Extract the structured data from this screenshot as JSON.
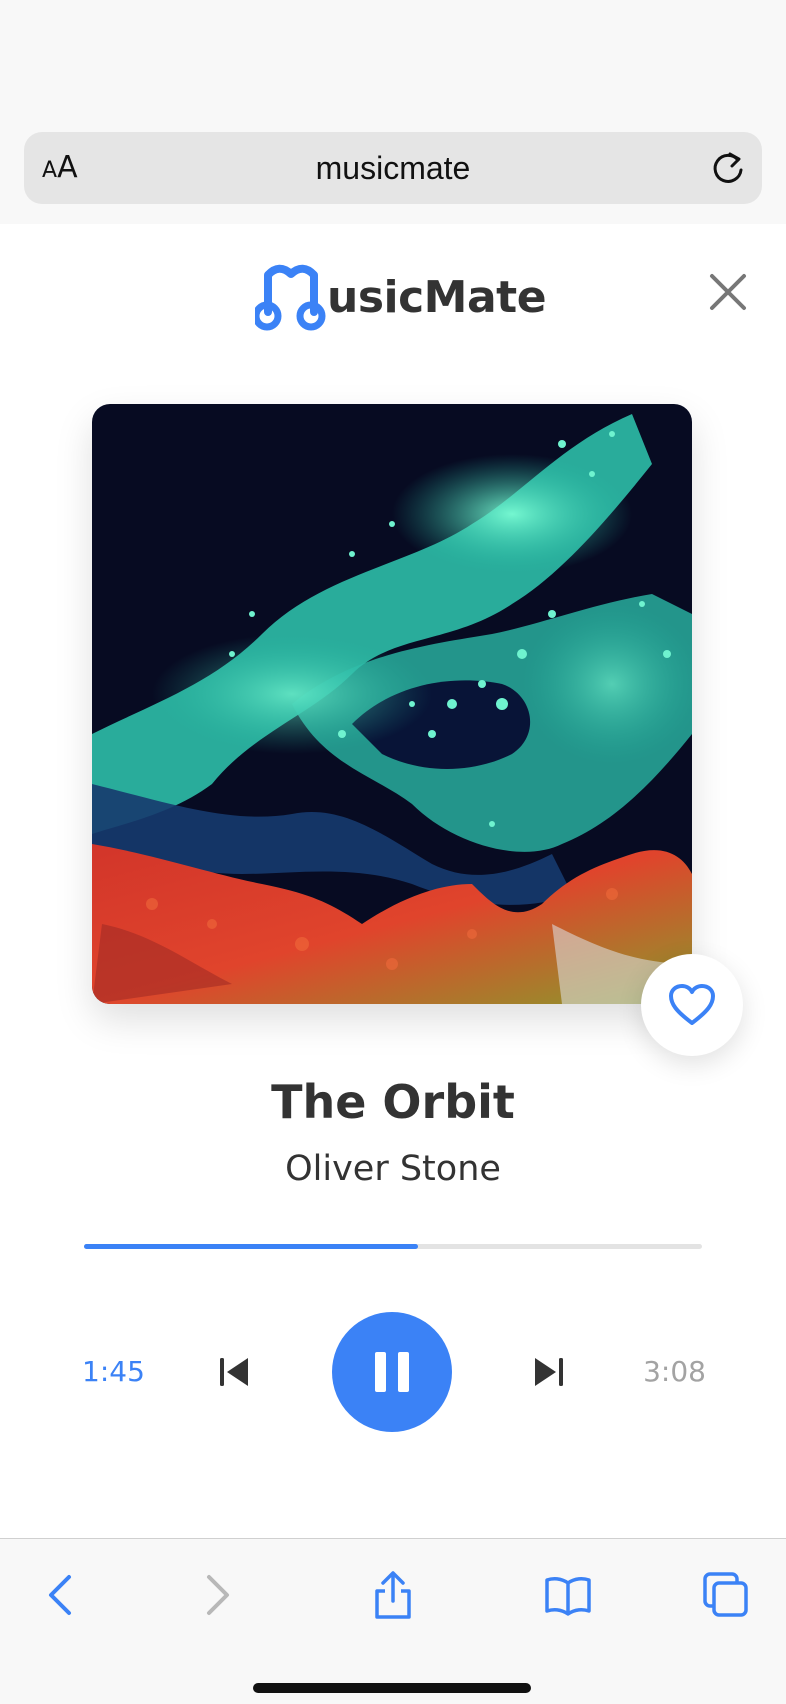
{
  "browser": {
    "text_size_label": "AA",
    "url": "musicmate"
  },
  "app": {
    "brand": "MusicMate",
    "brand_rest": "usicMate",
    "colors": {
      "accent": "#3b82f6",
      "text": "#333333",
      "muted": "#a3a3a3"
    }
  },
  "track": {
    "title": "The Orbit",
    "artist": "Oliver Stone",
    "elapsed": "1:45",
    "duration": "3:08",
    "progress_fraction": 0.54,
    "liked": false
  },
  "icons": {
    "text_size": "text-size-icon",
    "reload": "reload-icon",
    "close": "close-icon",
    "heart": "heart-outline-icon",
    "previous": "skip-previous-icon",
    "pause": "pause-icon",
    "next": "skip-next-icon",
    "back": "chevron-left-icon",
    "forward": "chevron-right-icon",
    "share": "share-icon",
    "bookmarks": "book-icon",
    "tabs": "tabs-icon"
  }
}
